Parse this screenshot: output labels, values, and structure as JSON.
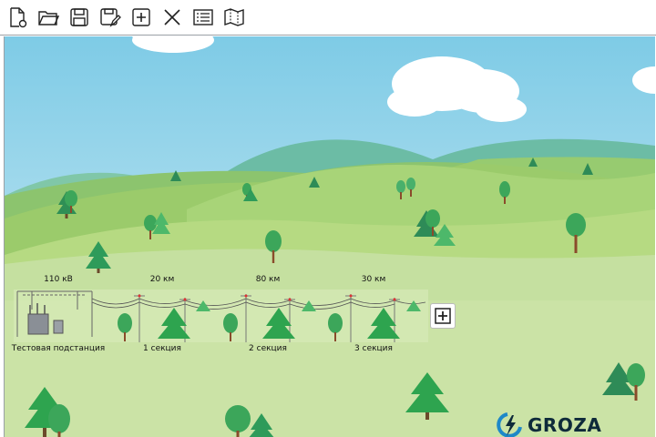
{
  "toolbar": {
    "icons": [
      "new-file-icon",
      "open-folder-icon",
      "save-icon",
      "save-as-icon",
      "add-icon",
      "close-icon",
      "list-icon",
      "map-icon"
    ]
  },
  "scheme": {
    "voltage_label": "110 кВ",
    "substation_label": "Тестовая подстанция",
    "sections": [
      {
        "name": "1 секция",
        "length": "20 км"
      },
      {
        "name": "2 секция",
        "length": "80 км"
      },
      {
        "name": "3 секция",
        "length": "30 км"
      }
    ]
  },
  "logo": {
    "text": "GROZA"
  },
  "colors": {
    "sky": "#8fd3e8",
    "grass": "#c9df8e",
    "hill_dark": "#6fb26a",
    "mountain": "#69b59c",
    "tree_green": "#2ea44f",
    "accent": "#1e88c8"
  }
}
